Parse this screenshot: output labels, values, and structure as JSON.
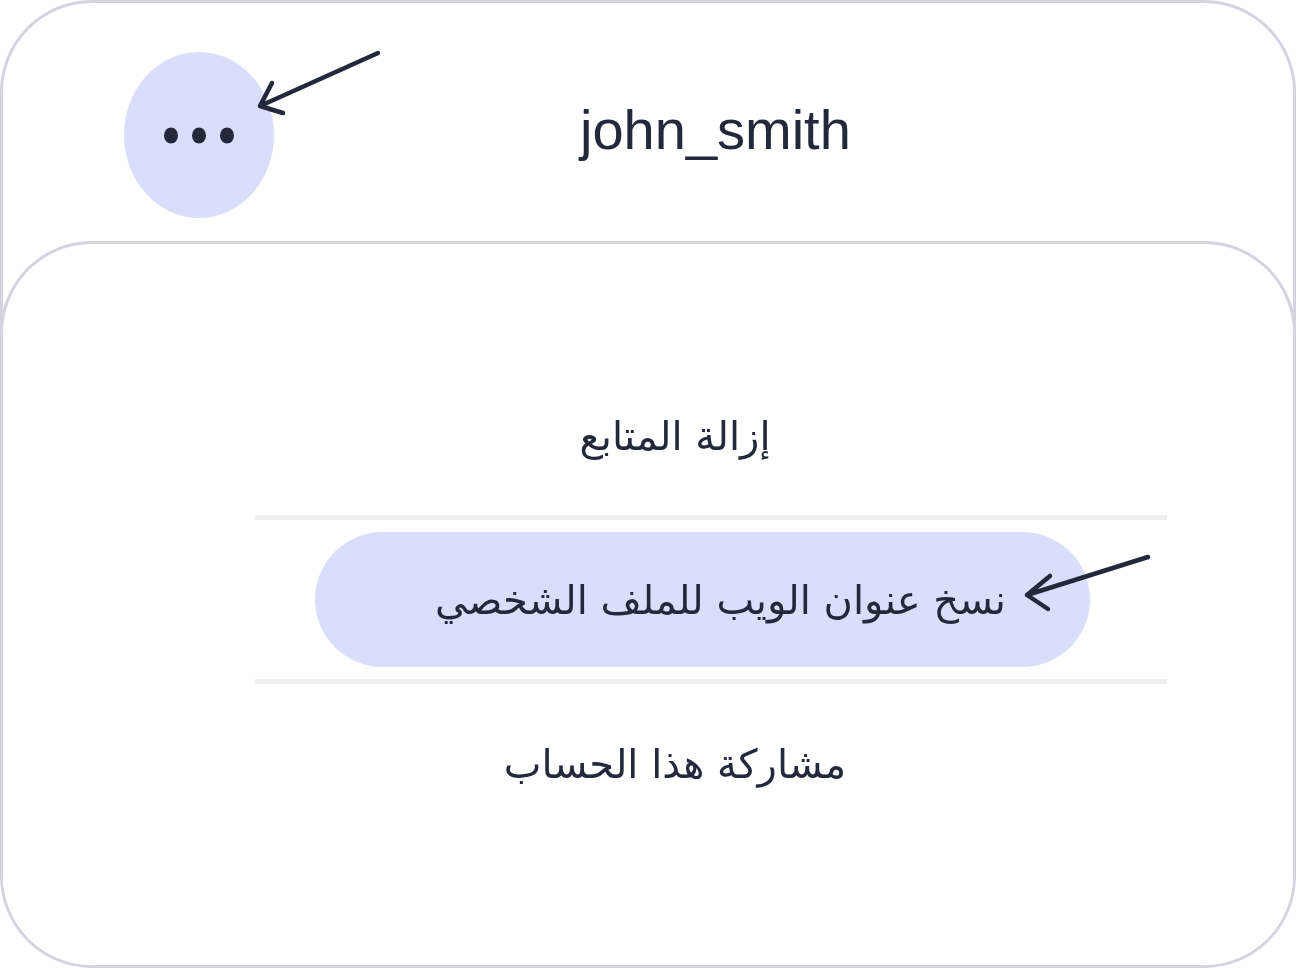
{
  "header": {
    "username": "john_smith"
  },
  "menu": {
    "items": [
      {
        "label": "إزالة المتابع",
        "selected": false
      },
      {
        "label": "نسخ عنوان الويب للملف الشخصي",
        "selected": true
      },
      {
        "label": "مشاركة هذا الحساب",
        "selected": false
      }
    ]
  }
}
